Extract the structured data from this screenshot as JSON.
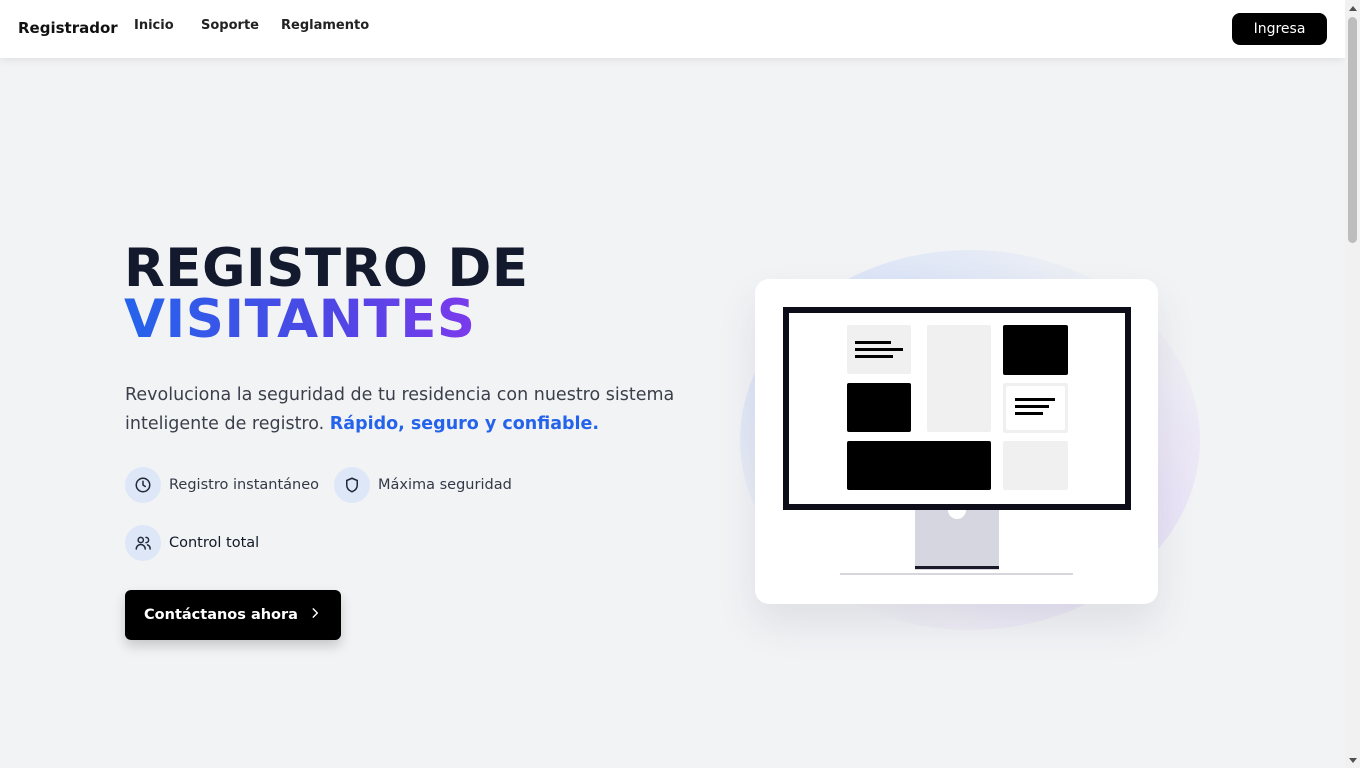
{
  "nav": {
    "brand": "Registrador",
    "links": [
      "Inicio",
      "Soporte",
      "Reglamento"
    ],
    "login_label": "Ingresa"
  },
  "hero": {
    "title_line1": "REGISTRO DE",
    "title_line2": "VISITANTES",
    "subtitle": "Revoluciona la seguridad de tu residencia con nuestro sistema inteligente de registro.",
    "subtitle_highlight": "Rápido, seguro y confiable.",
    "features": [
      {
        "label": "Registro instantáneo",
        "icon": "clock-icon"
      },
      {
        "label": "Máxima seguridad",
        "icon": "shield-icon"
      },
      {
        "label": "Control total",
        "icon": "users-icon"
      }
    ],
    "cta_label": "Contáctanos ahora"
  },
  "illustration": {
    "name": "monitor-illustration"
  },
  "colors": {
    "accent": "#2563eb",
    "gradient_end": "#7c3aed",
    "background": "#f2f3f5",
    "button": "#000000"
  }
}
